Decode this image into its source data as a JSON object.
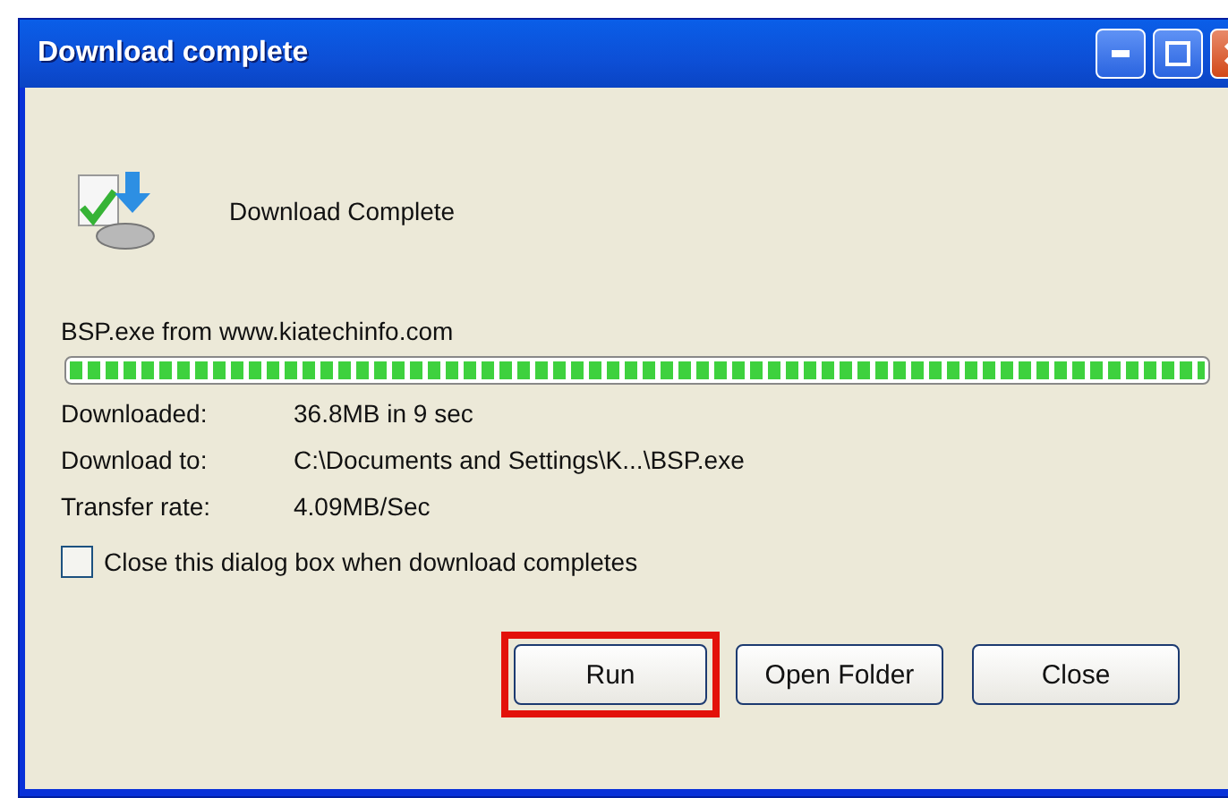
{
  "window": {
    "title": "Download complete"
  },
  "header": {
    "message": "Download Complete"
  },
  "source": "BSP.exe from www.kiatechinfo.com",
  "progress": {
    "level": 1
  },
  "details": [
    {
      "label": "Downloaded:",
      "value": "36.8MB in 9 sec"
    },
    {
      "label": "Download to:",
      "value": "C:\\Documents and Settings\\K...\\BSP.exe"
    },
    {
      "label": "Transfer rate:",
      "value": "4.09MB/Sec"
    }
  ],
  "close_when_done": {
    "label": "Close this dialog box when download completes",
    "checked": false
  },
  "buttons": [
    {
      "label": "Run",
      "highlighted": true
    },
    {
      "label": "Open Folder",
      "highlighted": false
    },
    {
      "label": "Close",
      "highlighted": false
    }
  ]
}
